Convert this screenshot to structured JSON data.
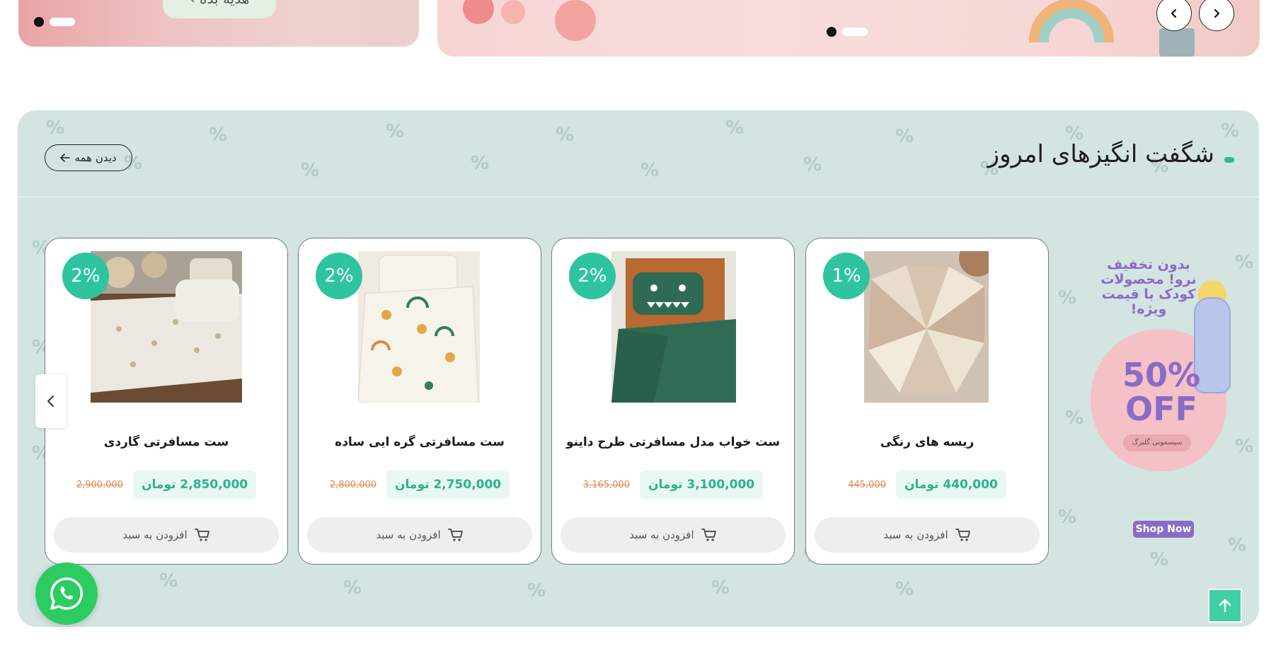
{
  "top_banners": {
    "left": {
      "button_label": "هدیه بده ›"
    }
  },
  "section": {
    "title": "شگفت انگیزهای امروز",
    "view_all_label": "دیدن همه"
  },
  "promo": {
    "headline": "بدون تخفیف نرو! محصولات کودک با قیمت ویژه!",
    "discount": "50% OFF",
    "brand": "سیسمونی گلبرگ",
    "cta": "Shop Now"
  },
  "products": [
    {
      "discount": "1%",
      "title": "ریسه های رنگی",
      "price": "440,000 تومان",
      "old_price": "445,000",
      "cart_label": "افزودن به سبد"
    },
    {
      "discount": "2%",
      "title": "ست خواب مدل مسافرتی طرح داینو",
      "price": "3,100,000 تومان",
      "old_price": "3,165,000",
      "cart_label": "افزودن به سبد"
    },
    {
      "discount": "2%",
      "title": "ست مسافرتی گره ایی ساده",
      "price": "2,750,000 تومان",
      "old_price": "2,800,000",
      "cart_label": "افزودن به سبد"
    },
    {
      "discount": "2%",
      "title": "ست مسافرتی گاردی",
      "price": "2,850,000 تومان",
      "old_price": "2,900,000",
      "cart_label": "افزودن به سبد"
    }
  ],
  "colors": {
    "accent": "#2ec4a0",
    "section_bg": "#d3e4e1",
    "price_text": "#29b48c",
    "old_price": "#d98c54",
    "promo_purple": "#8a6bc8",
    "whatsapp": "#2dcc63"
  },
  "icons": {
    "cart": "cart-icon",
    "arrow_left": "arrow-left-icon",
    "chevron_left": "chevron-left-icon",
    "chevron_right": "chevron-right-icon",
    "whatsapp": "whatsapp-icon",
    "arrow_up": "arrow-up-icon"
  }
}
